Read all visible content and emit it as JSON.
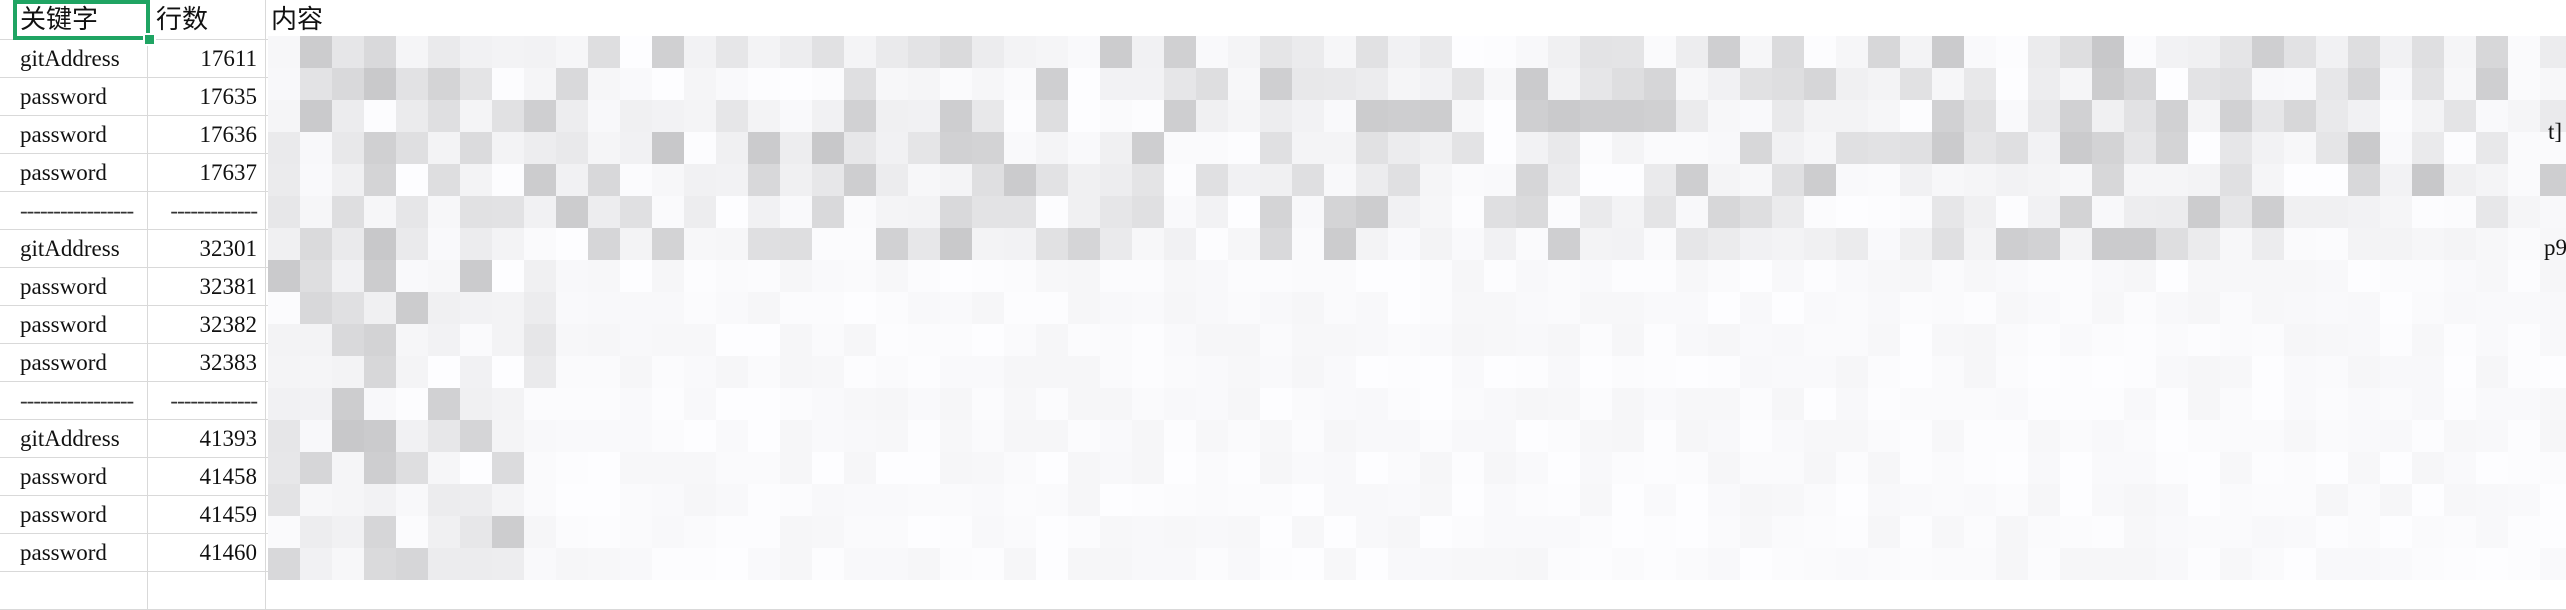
{
  "sheet": {
    "columns": [
      "关键字",
      "行数",
      "内容"
    ],
    "rows": [
      {
        "keyword": "gitAddress",
        "line": "17611",
        "content": "h"
      },
      {
        "keyword": "password",
        "line": "17635",
        "content": "/"
      },
      {
        "keyword": "password",
        "line": "17636",
        "content": "b"
      },
      {
        "keyword": "password",
        "line": "17637",
        "content": "/"
      },
      {
        "keyword": "-----------------",
        "line": "-------------",
        "content": "-"
      },
      {
        "keyword": "gitAddress",
        "line": "32301",
        "content": "h"
      },
      {
        "keyword": "password",
        "line": "32381",
        "content": "S"
      },
      {
        "keyword": "password",
        "line": "32382",
        "content": "S"
      },
      {
        "keyword": "password",
        "line": "32383",
        "content": "S"
      },
      {
        "keyword": "-----------------",
        "line": "-------------",
        "content": "-"
      },
      {
        "keyword": "gitAddress",
        "line": "41393",
        "content": "h"
      },
      {
        "keyword": "password",
        "line": "41458",
        "content": "S"
      },
      {
        "keyword": "password",
        "line": "41459",
        "content": "S"
      },
      {
        "keyword": "password",
        "line": "41460",
        "content": "S"
      }
    ],
    "edge_fragments": [
      "t]",
      "p9"
    ]
  }
}
